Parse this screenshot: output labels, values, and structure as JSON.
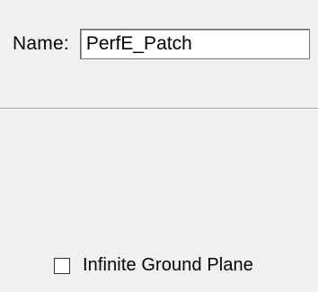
{
  "name_field": {
    "label": "Name:",
    "value": "PerfE_Patch"
  },
  "options": {
    "infinite_ground_plane": {
      "label": "Infinite Ground Plane",
      "checked": false
    }
  }
}
